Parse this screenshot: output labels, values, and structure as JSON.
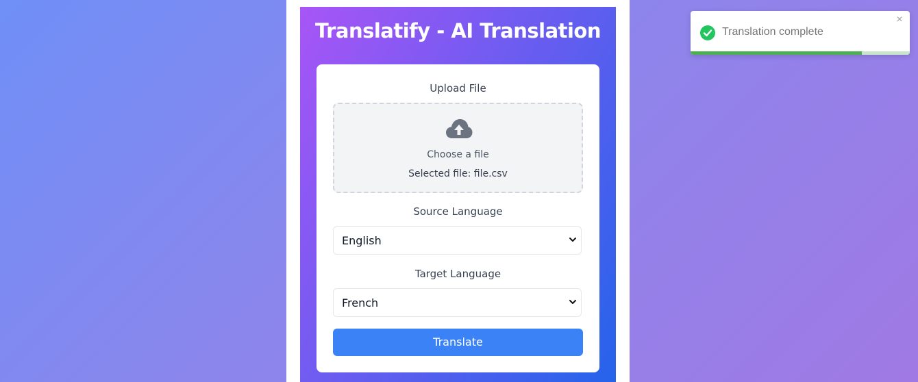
{
  "app": {
    "title": "Translatify - AI Translation"
  },
  "upload": {
    "label": "Upload File",
    "icon": "cloud-upload-icon",
    "choose_text": "Choose a file",
    "selected_text": "Selected file: file.csv"
  },
  "source_language": {
    "label": "Source Language",
    "value": "English"
  },
  "target_language": {
    "label": "Target Language",
    "value": "French"
  },
  "actions": {
    "translate_label": "Translate"
  },
  "toast": {
    "message": "Translation complete",
    "icon": "check-circle-icon",
    "close_glyph": "×",
    "progress": 0.78,
    "accent_color": "#4caf50"
  },
  "colors": {
    "primary_button": "#3b82f6",
    "panel_gradient_start": "#a855f7",
    "panel_gradient_end": "#2563eb",
    "success": "#22c55e"
  }
}
